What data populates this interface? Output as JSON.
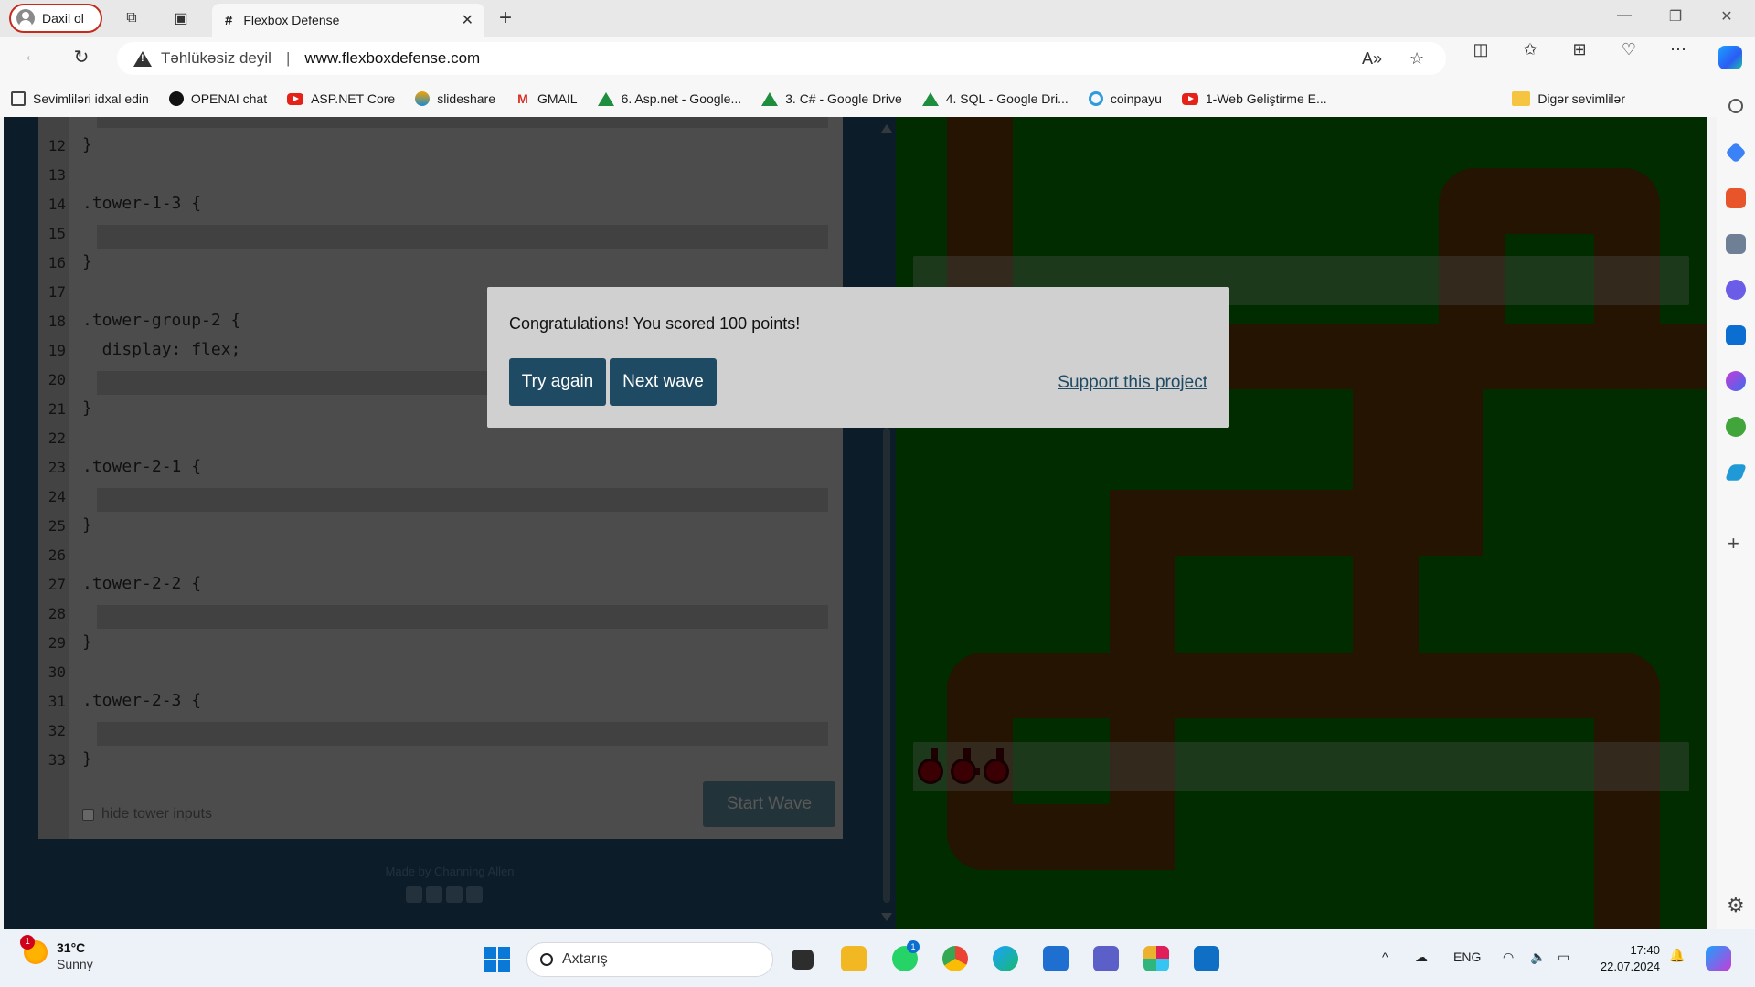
{
  "browser": {
    "profile_label": "Daxil ol",
    "tab_title": "Flexbox Defense",
    "security_label": "Təhlükəsiz deyil",
    "url": "www.flexboxdefense.com"
  },
  "bookmarks": [
    {
      "label": "Sevimliləri idxal edin",
      "icon": "import-icon"
    },
    {
      "label": "OPENAI chat",
      "icon": "openai-icon"
    },
    {
      "label": "ASP.NET Core",
      "icon": "youtube-icon"
    },
    {
      "label": "slideshare",
      "icon": "slideshare-icon"
    },
    {
      "label": "GMAIL",
      "icon": "gmail-icon"
    },
    {
      "label": "6. Asp.net - Google...",
      "icon": "google-drive-icon"
    },
    {
      "label": "3. C# - Google Drive",
      "icon": "google-drive-icon"
    },
    {
      "label": "4. SQL - Google Dri...",
      "icon": "google-drive-icon"
    },
    {
      "label": "coinpayu",
      "icon": "coinpayu-icon"
    },
    {
      "label": "1-Web Geliştirme E...",
      "icon": "youtube-icon"
    }
  ],
  "other_bookmarks": "Digər sevimlilər",
  "editor": {
    "line_numbers": [
      "12",
      "13",
      "14",
      "15",
      "16",
      "17",
      "18",
      "19",
      "20",
      "21",
      "22",
      "23",
      "24",
      "25",
      "26",
      "27",
      "28",
      "29",
      "30",
      "31",
      "32",
      "33"
    ],
    "code_lines": {
      "l12": "}",
      "l14": ".tower-1-3 {",
      "l16": "}",
      "l18": ".tower-group-2 {",
      "l19": "  display: flex;",
      "l21": "}",
      "l23": ".tower-2-1 {",
      "l25": "}",
      "l27": ".tower-2-2 {",
      "l29": "}",
      "l31": ".tower-2-3 {",
      "l33": "}"
    },
    "hide_inputs_label": "hide tower inputs",
    "start_wave_label": "Start Wave"
  },
  "credit": "Made by Channing Allen",
  "modal": {
    "message": "Congratulations! You scored 100 points!",
    "try_again": "Try again",
    "next_wave": "Next wave",
    "support": "Support this project"
  },
  "taskbar": {
    "weather_temp": "31°C",
    "weather_desc": "Sunny",
    "weather_badge": "1",
    "search_placeholder": "Axtarış",
    "whatsapp_badge": "1",
    "language": "ENG",
    "time": "17:40",
    "date": "22.07.2024"
  },
  "colors": {
    "map_grass": "#005100",
    "map_path": "#432502",
    "panel_bg": "#18344b",
    "button_primary": "#1f4a63",
    "tower": "#6b0008"
  }
}
